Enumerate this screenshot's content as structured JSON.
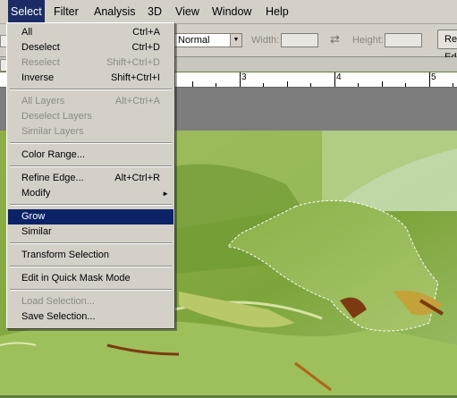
{
  "menubar": {
    "items": [
      {
        "label": "Select",
        "active": true
      },
      {
        "label": "Filter"
      },
      {
        "label": "Analysis"
      },
      {
        "label": "3D"
      },
      {
        "label": "View"
      },
      {
        "label": "Window"
      },
      {
        "label": "Help"
      }
    ]
  },
  "options": {
    "style_value": "Normal",
    "width_label": "Width:",
    "height_label": "Height:",
    "refine_label": "Refine Edge..."
  },
  "ruler": {
    "marks": [
      "3",
      "4",
      "5"
    ]
  },
  "menu": {
    "items": [
      {
        "label": "All",
        "shortcut": "Ctrl+A"
      },
      {
        "label": "Deselect",
        "shortcut": "Ctrl+D"
      },
      {
        "label": "Reselect",
        "shortcut": "Shift+Ctrl+D",
        "disabled": true
      },
      {
        "label": "Inverse",
        "shortcut": "Shift+Ctrl+I"
      },
      {
        "label": "All Layers",
        "shortcut": "Alt+Ctrl+A",
        "disabled": true
      },
      {
        "label": "Deselect Layers",
        "disabled": true
      },
      {
        "label": "Similar Layers",
        "disabled": true
      },
      {
        "label": "Color Range..."
      },
      {
        "label": "Refine Edge...",
        "shortcut": "Alt+Ctrl+R"
      },
      {
        "label": "Modify",
        "submenu": true
      },
      {
        "label": "Grow",
        "highlighted": true
      },
      {
        "label": "Similar"
      },
      {
        "label": "Transform Selection"
      },
      {
        "label": "Edit in Quick Mask Mode"
      },
      {
        "label": "Load Selection...",
        "disabled": true
      },
      {
        "label": "Save Selection..."
      }
    ]
  },
  "colors": {
    "menu_bg": "#d4d0c8",
    "highlight": "#0b2366",
    "disabled_text": "#8c8a84",
    "leaf_green": "#7fa83a"
  }
}
